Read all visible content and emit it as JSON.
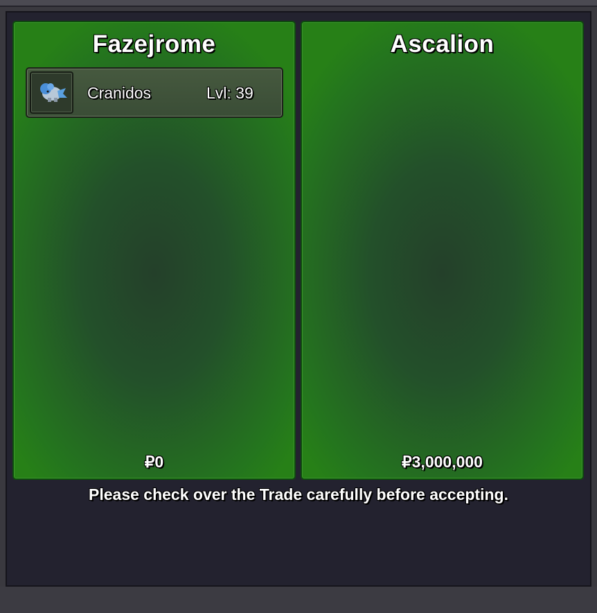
{
  "trade": {
    "left": {
      "player_name": "Fazejrome",
      "items": [
        {
          "name": "Cranidos",
          "level": "Lvl: 39",
          "icon": "cranidos-sprite-icon"
        }
      ],
      "currency_symbol": "₽",
      "money": "0"
    },
    "right": {
      "player_name": "Ascalion",
      "items": [],
      "currency_symbol": "₽",
      "money": "3,000,000"
    },
    "notice": "Please check over the Trade carefully before accepting."
  },
  "colors": {
    "panel_green": "#278017",
    "panel_dark_center": "#24402a",
    "window_bg": "#23222f"
  }
}
